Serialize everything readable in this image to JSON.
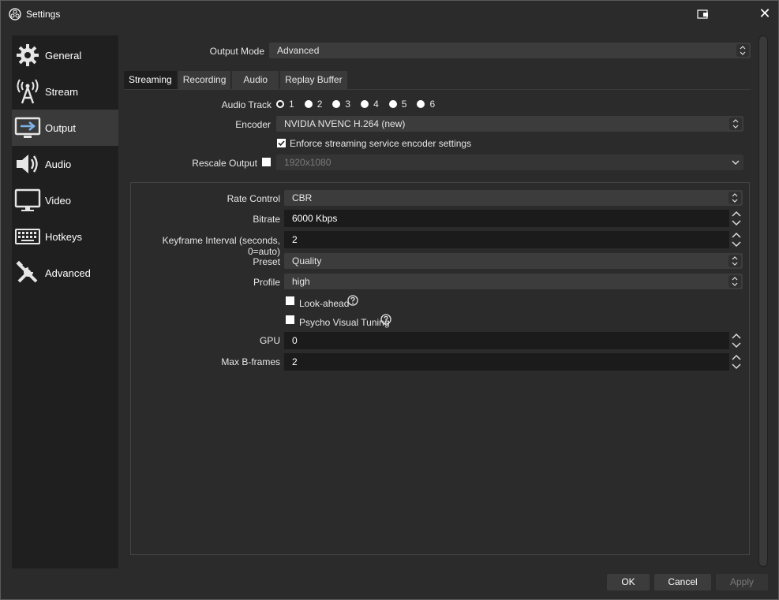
{
  "window": {
    "title": "Settings"
  },
  "sidebar": {
    "items": [
      {
        "label": "General",
        "icon": "gear-icon"
      },
      {
        "label": "Stream",
        "icon": "antenna-icon"
      },
      {
        "label": "Output",
        "icon": "monitor-arrow-icon"
      },
      {
        "label": "Audio",
        "icon": "speaker-icon"
      },
      {
        "label": "Video",
        "icon": "monitor-icon"
      },
      {
        "label": "Hotkeys",
        "icon": "keyboard-icon"
      },
      {
        "label": "Advanced",
        "icon": "tools-icon"
      }
    ],
    "active": "Output"
  },
  "output_mode": {
    "label": "Output Mode",
    "value": "Advanced"
  },
  "tabs": [
    "Streaming",
    "Recording",
    "Audio",
    "Replay Buffer"
  ],
  "active_tab": "Streaming",
  "audio_track": {
    "label": "Audio Track",
    "options": [
      "1",
      "2",
      "3",
      "4",
      "5",
      "6"
    ],
    "selected": "1"
  },
  "encoder": {
    "label": "Encoder",
    "value": "NVIDIA NVENC H.264 (new)"
  },
  "enforce": {
    "label": "Enforce streaming service encoder settings",
    "checked": true
  },
  "rescale": {
    "label": "Rescale Output",
    "checked": false,
    "value": "1920x1080"
  },
  "rate_control": {
    "label": "Rate Control",
    "value": "CBR"
  },
  "bitrate": {
    "label": "Bitrate",
    "value": "6000 Kbps"
  },
  "keyframe": {
    "label": "Keyframe Interval (seconds, 0=auto)",
    "value": "2"
  },
  "preset": {
    "label": "Preset",
    "value": "Quality"
  },
  "profile": {
    "label": "Profile",
    "value": "high"
  },
  "lookahead": {
    "label": "Look-ahead",
    "checked": false
  },
  "psycho": {
    "label": "Psycho Visual Tuning",
    "checked": false
  },
  "gpu": {
    "label": "GPU",
    "value": "0"
  },
  "bframes": {
    "label": "Max B-frames",
    "value": "2"
  },
  "buttons": {
    "ok": "OK",
    "cancel": "Cancel",
    "apply": "Apply"
  }
}
